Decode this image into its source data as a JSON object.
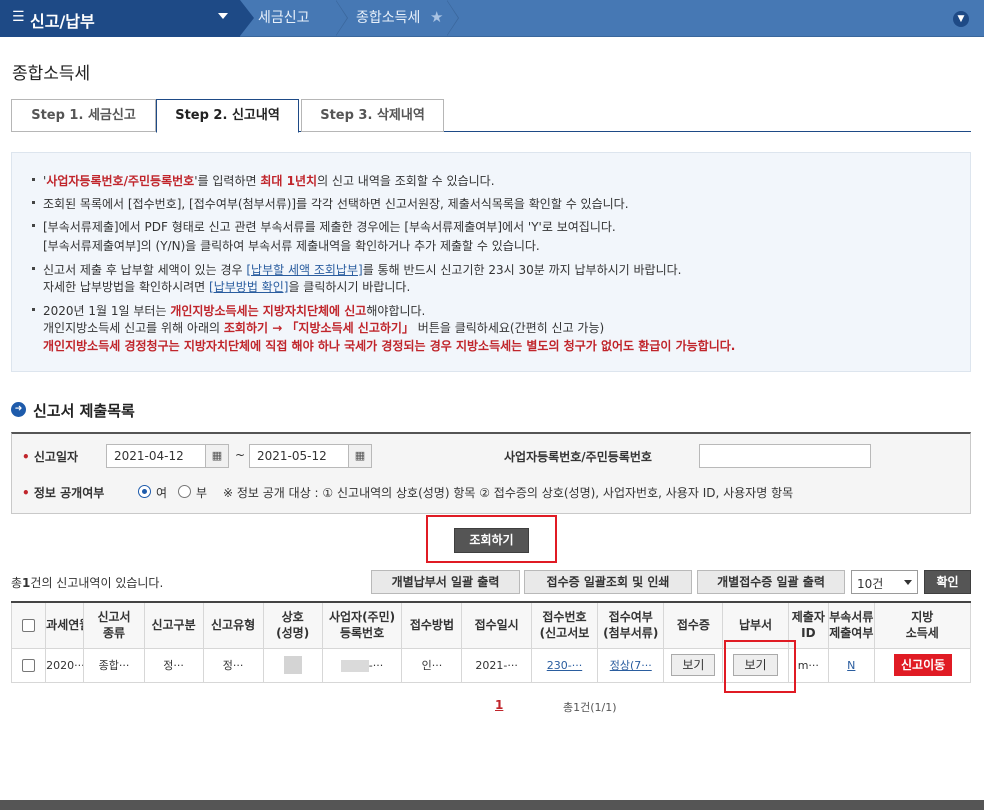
{
  "nav": {
    "menu_label": "신고/납부",
    "crumbs": [
      "세금신고",
      "종합소득세"
    ]
  },
  "page_title": "종합소득세",
  "tabs": [
    {
      "label": "Step 1. 세금신고"
    },
    {
      "label": "Step 2. 신고내역"
    },
    {
      "label": "Step 3. 삭제내역"
    }
  ],
  "notice": {
    "l1_a": "'",
    "l1_b": "사업자등록번호/주민등록번호",
    "l1_c": "'를 입력하면 ",
    "l1_d": "최대 1년치",
    "l1_e": "의 신고 내역을 조회할 수 있습니다.",
    "l2": "조회된 목록에서 [접수번호], [접수여부(첨부서류)]를 각각 선택하면 신고서원장, 제출서식목록을 확인할 수 있습니다.",
    "l3": "[부속서류제출]에서 PDF 형태로 신고 관련 부속서류를 제출한 경우에는 [부속서류제출여부]에서 'Y'로 보여집니다.",
    "l4": "[부속서류제출여부]의 (Y/N)을 클릭하여 부속서류 제출내역을 확인하거나 추가 제출할 수 있습니다.",
    "l5_a": "신고서 제출 후 납부할 세액이 있는 경우 ",
    "l5_b": "[납부할 세액 조회납부]",
    "l5_c": "를 통해 반드시 신고기한 23시 30분 까지 납부하시기 바랍니다.",
    "l6_a": "자세한 납부방법을 확인하시려면 ",
    "l6_b": "[납부방법 확인]",
    "l6_c": "을 클릭하시기 바랍니다.",
    "l7_a": "2020년 1월 1일 부터는 ",
    "l7_b": "개인지방소득세는 지방자치단체에 신고",
    "l7_c": "해야합니다.",
    "l8_a": "개인지방소득세 신고를 위해 아래의 ",
    "l8_b": "조회하기 → 「지방소득세 신고하기」",
    "l8_c": " 버튼을 클릭하세요(간편히 신고 가능)",
    "l9": "개인지방소득세 경정청구는 지방자치단체에 직접 해야 하나 국세가 경정되는 경우 지방소득세는 별도의 청구가 없어도 환급이 가능합니다."
  },
  "section_title": "신고서 제출목록",
  "search": {
    "date_label": "신고일자",
    "date_from": "2021-04-12",
    "date_to": "2021-05-12",
    "tilde": "~",
    "id_label": "사업자등록번호/주민등록번호",
    "id_value": "",
    "public_label": "정보 공개여부",
    "yes": "여",
    "no": "부",
    "public_note": "※ 정보 공개 대상 : ① 신고내역의 상호(성명) 항목 ② 접수증의 상호(성명), 사업자번호, 사용자 ID, 사용자명 항목",
    "search_button": "조회하기"
  },
  "list": {
    "count_pre": "총",
    "count_num": "1",
    "count_post": "건의 신고내역이 있습니다.",
    "btn_print_pay": "개별납부서 일괄 출력",
    "btn_print_receipt": "접수증 일괄조회 및 인쇄",
    "btn_print_each": "개별접수증 일괄 출력",
    "page_size": "10건",
    "confirm": "확인"
  },
  "table": {
    "headers": [
      [
        "과세연월"
      ],
      [
        "신고서",
        "종류"
      ],
      [
        "신고구분"
      ],
      [
        "신고유형"
      ],
      [
        "상호",
        "(성명)"
      ],
      [
        "사업자(주민)",
        "등록번호"
      ],
      [
        "접수방법"
      ],
      [
        "접수일시"
      ],
      [
        "접수번호",
        "(신고서보"
      ],
      [
        "접수여부",
        "(첨부서류)"
      ],
      [
        "접수증"
      ],
      [
        "납부서"
      ],
      [
        "제출자",
        "ID"
      ],
      [
        "부속서류",
        "제출여부"
      ],
      [
        "지방",
        "소득세"
      ]
    ],
    "row": {
      "year_month": "2020···",
      "type": "종합···",
      "category": "정···",
      "form": "정···",
      "regno_suffix": "-···",
      "method": "인···",
      "date": "2021-···",
      "receipt_no": "230-···",
      "status": "정상(7···",
      "receipt_btn": "보기",
      "payment_btn": "보기",
      "submitter": "m···",
      "attach": "N",
      "local_btn": "신고이동"
    }
  },
  "pagination": {
    "current": "1",
    "info": "총1건(1/1)"
  }
}
